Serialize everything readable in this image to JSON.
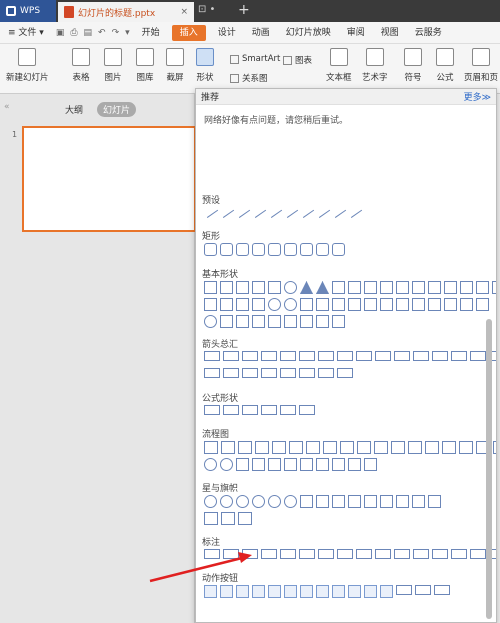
{
  "titlebar": {
    "app": "WPS",
    "doc_tab": "幻灯片的标题.pptx",
    "close": "×",
    "new_tab": "+",
    "monitor": "⊡ •"
  },
  "menubar": {
    "file": "文件",
    "items": [
      "开始",
      "插入",
      "设计",
      "动画",
      "幻灯片放映",
      "审阅",
      "视图",
      "云服务"
    ],
    "active": "插入"
  },
  "ribbon": {
    "new_slide": "新建幻灯片",
    "table": "表格",
    "picture": "图片",
    "gallery": "图库",
    "screenshot": "截屏",
    "shape": "形状",
    "smartart": "SmartArt",
    "chart": "图表",
    "relation": "关系图",
    "textbox": "文本框",
    "arttext": "艺术字",
    "symbol": "符号",
    "formula": "公式",
    "header": "页眉和页"
  },
  "left": {
    "collapse": "«",
    "outline": "大纲",
    "slides": "幻灯片",
    "slide_num": "1"
  },
  "panel": {
    "recommend": "推荐",
    "more": "更多≫",
    "message": "网络好像有点问题，请您稍后重试。",
    "sections": [
      "预设",
      "矩形",
      "基本形状",
      "箭头总汇",
      "公式形状",
      "流程图",
      "星与旗帜",
      "标注",
      "动作按钮"
    ]
  },
  "colors": {
    "accent": "#e8742a",
    "titlebar": "#3a3a3a",
    "arrow": "#e02020",
    "shape_stroke": "#6b86b8"
  }
}
